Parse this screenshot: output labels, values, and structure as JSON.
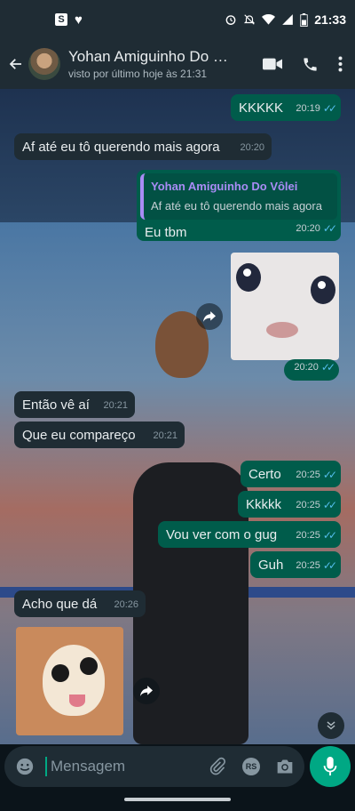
{
  "status_bar": {
    "time": "21:33",
    "left_icons": [
      "s-app-icon",
      "heart-icon"
    ],
    "right_icons": [
      "alarm-icon",
      "mute-icon",
      "wifi-icon",
      "signal-icon",
      "battery-icon"
    ]
  },
  "header": {
    "contact_name": "Yohan Amiguinho Do Vôlei",
    "last_seen": "visto por último hoje às 21:31"
  },
  "messages": [
    {
      "dir": "out",
      "text": "KKKKK",
      "time": "20:19",
      "read": true
    },
    {
      "dir": "in",
      "text": "Af até eu tô querendo mais agora",
      "time": "20:20"
    },
    {
      "dir": "out",
      "reply_author": "Yohan Amiguinho Do Vôlei",
      "reply_text": "Af até eu tô querendo mais agora",
      "text": "Eu tbm",
      "time": "20:20",
      "read": true
    },
    {
      "dir": "out",
      "type": "sticker",
      "sticker": "crying-cat",
      "time": "20:20",
      "read": true
    },
    {
      "dir": "in",
      "text": "Então vê aí",
      "time": "20:21"
    },
    {
      "dir": "in",
      "text": "Que eu compareço",
      "time": "20:21"
    },
    {
      "dir": "out",
      "text": "Certo",
      "time": "20:25",
      "read": true
    },
    {
      "dir": "out",
      "text": "Kkkkk",
      "time": "20:25",
      "read": true
    },
    {
      "dir": "out",
      "text": "Vou ver com o gug",
      "time": "20:25",
      "read": true
    },
    {
      "dir": "out",
      "text": "Guh",
      "time": "20:25",
      "read": true
    },
    {
      "dir": "in",
      "text": "Acho que dá",
      "time": "20:26"
    },
    {
      "dir": "in",
      "type": "sticker",
      "sticker": "chihuahua"
    }
  ],
  "compose": {
    "placeholder": "Mensagem",
    "rs_label": "RS"
  },
  "colors": {
    "header": "#1f2c34",
    "incoming": "#1f2c34",
    "outgoing": "#005c4b",
    "accent": "#00a884",
    "read_ticks": "#53bdeb",
    "quote_bar": "#a98cf5"
  }
}
